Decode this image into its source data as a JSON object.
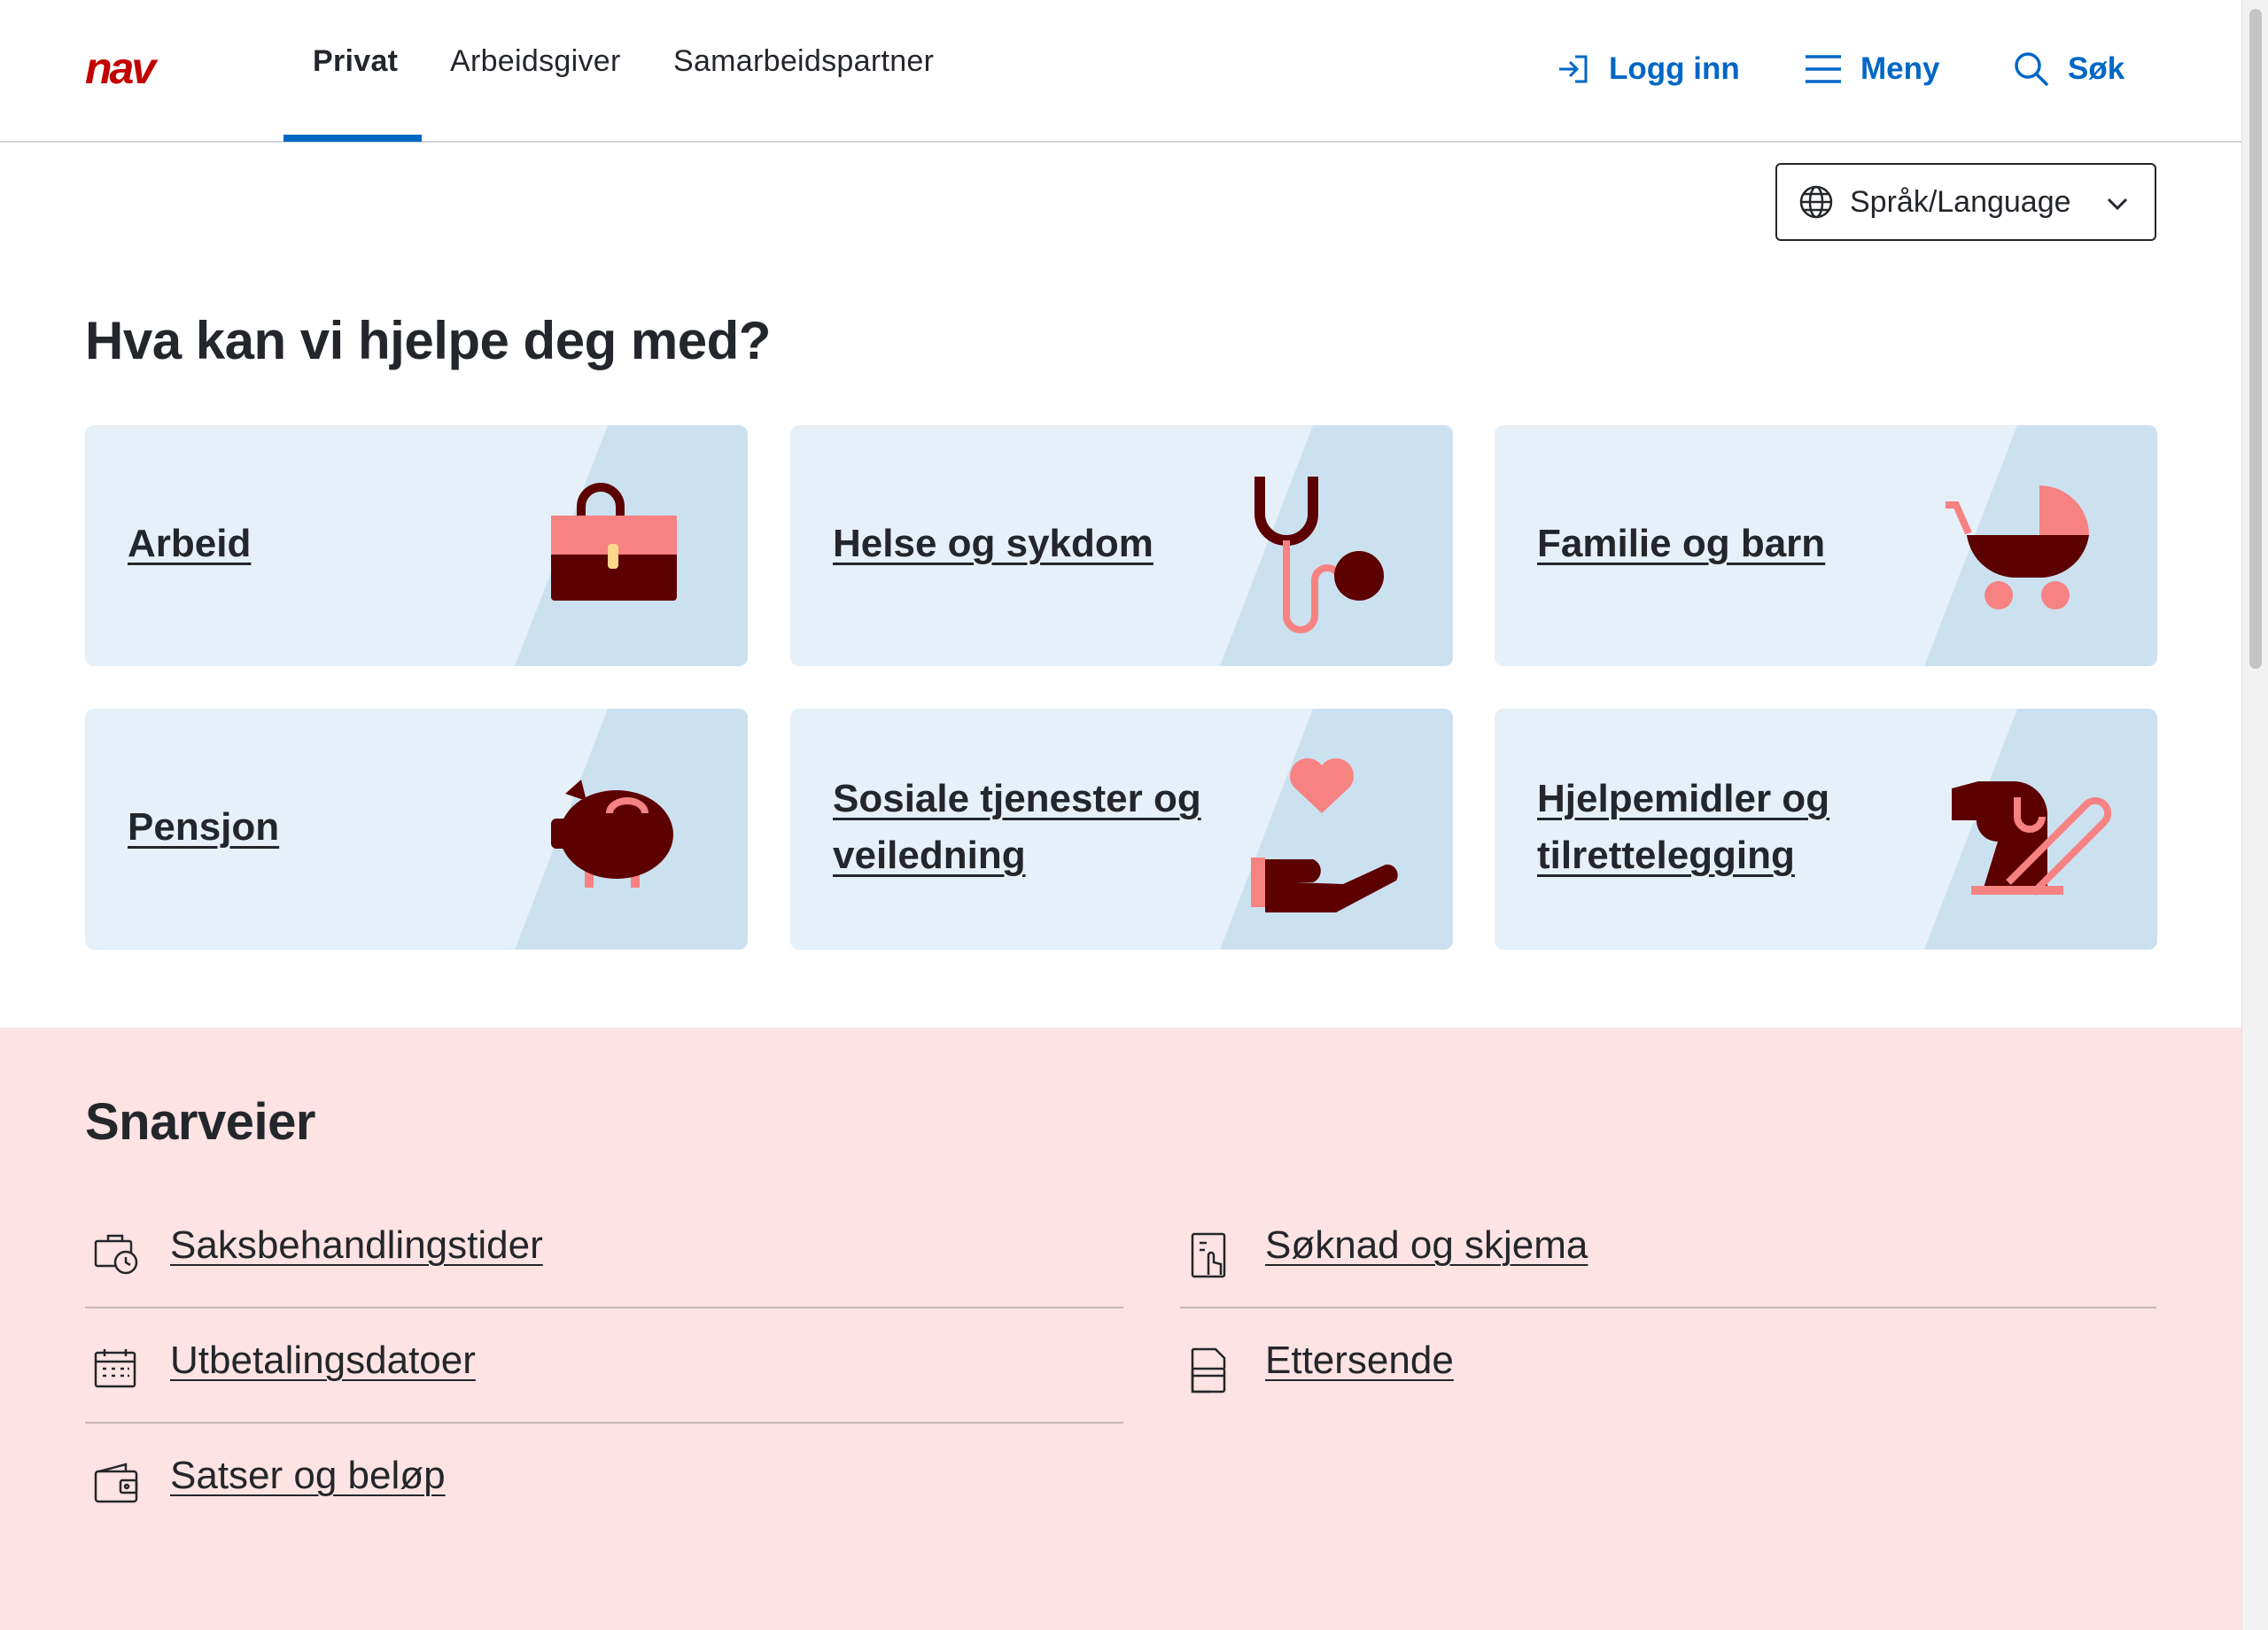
{
  "header": {
    "logo": "nav",
    "tabs": [
      "Privat",
      "Arbeidsgiver",
      "Samarbeidspartner"
    ],
    "login_label": "Logg inn",
    "menu_label": "Meny",
    "search_label": "Søk"
  },
  "language": {
    "label": "Språk/Language"
  },
  "main": {
    "title": "Hva kan vi hjelpe deg med?",
    "cards": [
      {
        "label": "Arbeid",
        "icon": "briefcase-icon"
      },
      {
        "label": "Helse og sykdom",
        "icon": "stethoscope-icon"
      },
      {
        "label": "Familie og barn",
        "icon": "stroller-icon"
      },
      {
        "label": "Pensjon",
        "icon": "piggy-bank-icon"
      },
      {
        "label": "Sosiale tjenester og veiledning",
        "icon": "heart-hand-icon"
      },
      {
        "label": "Hjelpemidler og tilrettelegging",
        "icon": "guide-dog-icon"
      }
    ]
  },
  "shortcuts": {
    "title": "Snarveier",
    "items": [
      {
        "label": "Saksbehandlingstider",
        "icon": "clock-case-icon"
      },
      {
        "label": "Søknad og skjema",
        "icon": "form-touch-icon"
      },
      {
        "label": "Utbetalingsdatoer",
        "icon": "calendar-icon"
      },
      {
        "label": "Ettersende",
        "icon": "document-send-icon"
      },
      {
        "label": "Satser og beløp",
        "icon": "wallet-icon"
      }
    ]
  },
  "colors": {
    "accent_blue": "#0067c5",
    "nav_red": "#c30000",
    "card_bg": "#e6f0f8",
    "card_diag": "#cce1f0",
    "illustration_dark": "#5c0000",
    "illustration_pink": "#f68282",
    "shortcuts_bg": "#fde3e3"
  }
}
